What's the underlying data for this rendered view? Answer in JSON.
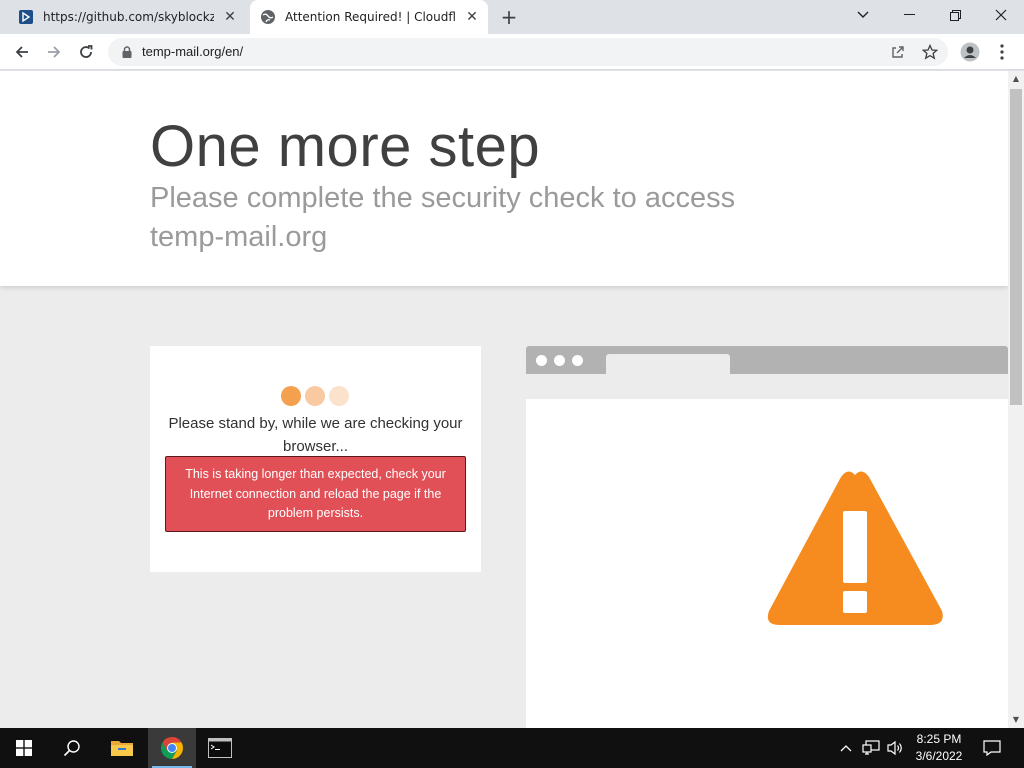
{
  "browser": {
    "tabs": [
      {
        "title": "https://github.com/skyblockz/RE",
        "icon": "document-icon",
        "active": false
      },
      {
        "title": "Attention Required! | Cloudflare",
        "icon": "globe-icon",
        "active": true
      }
    ],
    "address": {
      "url": "temp-mail.org/en/",
      "secure": true
    },
    "window_controls": [
      "tab-search",
      "minimize",
      "restore",
      "close"
    ]
  },
  "page": {
    "heading": "One more step",
    "subheading": "Please complete the security check to access temp-mail.org",
    "status_text": "Please stand by, while we are checking your browser...",
    "error_text": "This is taking longer than expected, check your Internet connection and reload the page if the problem persists.",
    "colors": {
      "heading": "#404040",
      "subheading": "#9a9a9a",
      "error_bg": "#e25057",
      "dot_1": "#f5a04e",
      "dot_2": "#f9c9a2",
      "dot_3": "#fbe2cd",
      "warning": "#f68b1f"
    }
  },
  "taskbar": {
    "pinned": [
      "windows-start-icon",
      "search-icon",
      "file-explorer-icon",
      "chrome-icon",
      "terminal-icon"
    ],
    "active_app": "chrome-icon",
    "tray_icons": [
      "chevron-up-icon",
      "network-icon",
      "volume-icon"
    ],
    "time": "8:25 PM",
    "date": "3/6/2022"
  }
}
